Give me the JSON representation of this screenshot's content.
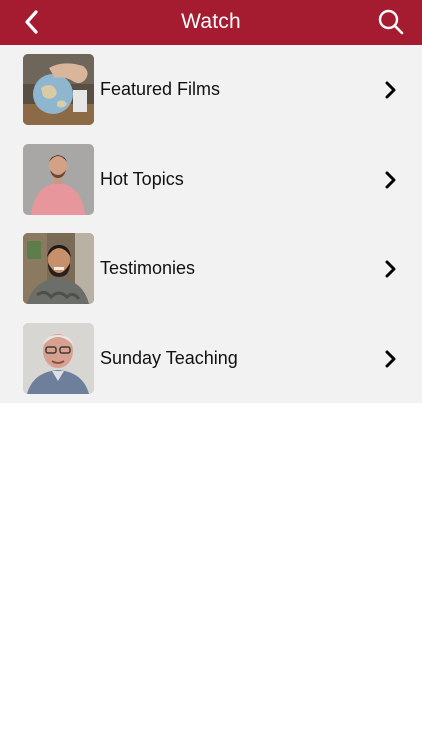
{
  "header": {
    "title": "Watch",
    "back_icon": "chevron-left-icon",
    "search_icon": "search-icon",
    "background_color": "#a51c30"
  },
  "list": {
    "items": [
      {
        "label": "Featured Films",
        "thumbnail": "globe-in-hand-thumbnail"
      },
      {
        "label": "Hot Topics",
        "thumbnail": "man-in-pink-shirt-thumbnail"
      },
      {
        "label": "Testimonies",
        "thumbnail": "bearded-man-thumbnail"
      },
      {
        "label": "Sunday Teaching",
        "thumbnail": "older-man-glasses-thumbnail"
      }
    ],
    "chevron_icon": "chevron-right-icon"
  }
}
